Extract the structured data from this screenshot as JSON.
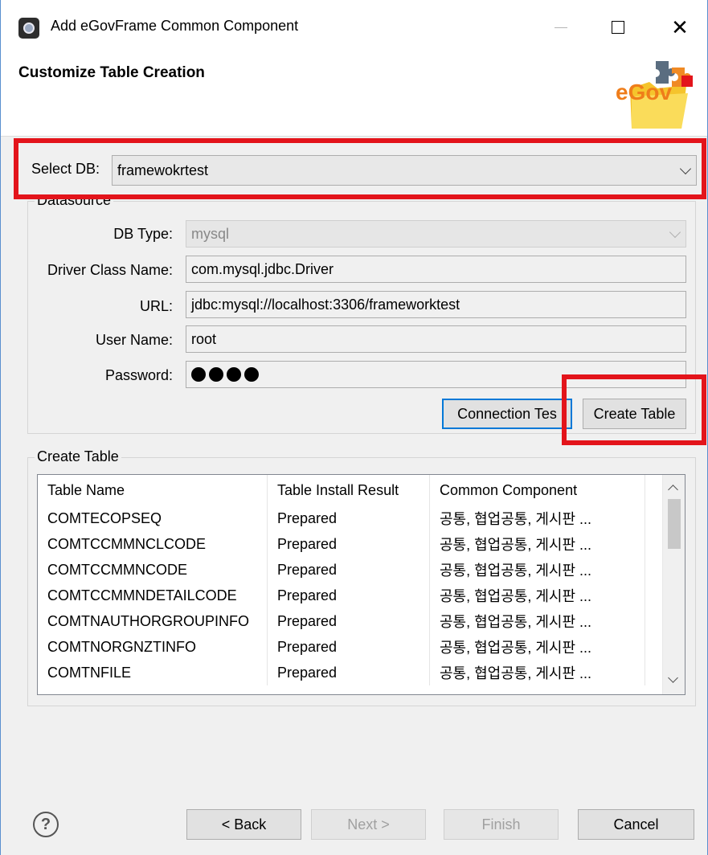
{
  "window": {
    "title": "Add eGovFrame Common Component",
    "close_glyph": "✕"
  },
  "header": {
    "title": "Customize Table Creation",
    "logo_text": "eGov"
  },
  "select_db": {
    "label": "Select DB:",
    "value": "framewokrtest"
  },
  "datasource": {
    "group_label": "Datasource",
    "db_type": {
      "label": "DB Type:",
      "value": "mysql"
    },
    "driver_class": {
      "label": "Driver Class Name:",
      "value": "com.mysql.jdbc.Driver"
    },
    "url": {
      "label": "URL:",
      "value": "jdbc:mysql://localhost:3306/frameworktest"
    },
    "user_name": {
      "label": "User Name:",
      "value": "root"
    },
    "password": {
      "label": "Password:",
      "dot_count": 4
    },
    "connection_test_label": "Connection Tes",
    "create_table_label": "Create Table"
  },
  "create_table": {
    "group_label": "Create Table",
    "columns": [
      "Table Name",
      "Table Install Result",
      "Common Component"
    ],
    "rows": [
      [
        "COMTECOPSEQ",
        "Prepared",
        "공통, 협업공통, 게시판 ..."
      ],
      [
        "COMTCCMMNCLCODE",
        "Prepared",
        "공통, 협업공통, 게시판 ..."
      ],
      [
        "COMTCCMMNCODE",
        "Prepared",
        "공통, 협업공통, 게시판 ..."
      ],
      [
        "COMTCCMMNDETAILCODE",
        "Prepared",
        "공통, 협업공통, 게시판 ..."
      ],
      [
        "COMTNAUTHORGROUPINFO",
        "Prepared",
        "공통, 협업공통, 게시판 ..."
      ],
      [
        "COMTNORGNZTINFO",
        "Prepared",
        "공통, 협업공통, 게시판 ..."
      ],
      [
        "COMTNFILE",
        "Prepared",
        "공통, 협업공통, 게시판 ..."
      ]
    ]
  },
  "footer": {
    "help_glyph": "?",
    "back_label": "< Back",
    "next_label": "Next >",
    "finish_label": "Finish",
    "cancel_label": "Cancel"
  },
  "colors": {
    "highlight_red": "#e3141b",
    "focus_blue": "#0078d7"
  }
}
